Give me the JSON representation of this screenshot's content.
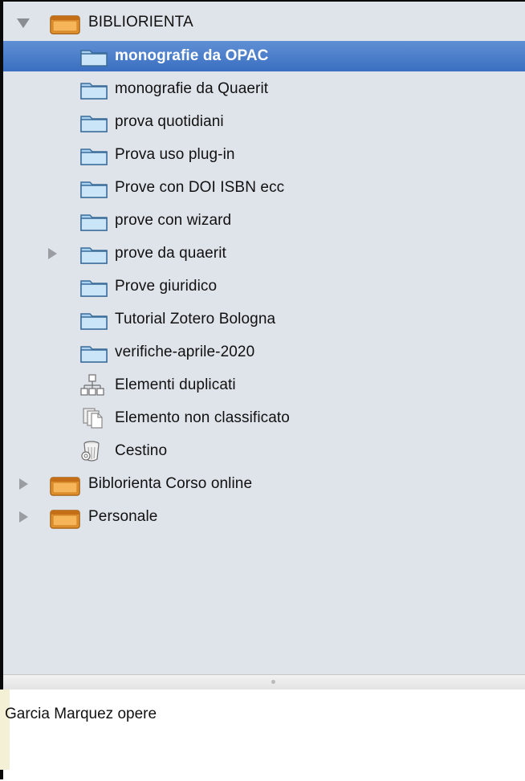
{
  "tree": {
    "root": {
      "label": "BIBLIORIENTA",
      "icon": "library-icon",
      "expanded": true
    },
    "items": [
      {
        "label": "monografie da OPAC",
        "icon": "folder-icon",
        "selected": true
      },
      {
        "label": "monografie da Quaerit",
        "icon": "folder-icon"
      },
      {
        "label": "prova quotidiani",
        "icon": "folder-icon"
      },
      {
        "label": "Prova uso plug-in",
        "icon": "folder-icon"
      },
      {
        "label": "Prove con DOI ISBN ecc",
        "icon": "folder-icon"
      },
      {
        "label": "prove con wizard",
        "icon": "folder-icon"
      },
      {
        "label": "prove da quaerit",
        "icon": "folder-icon",
        "has_children": true
      },
      {
        "label": "Prove giuridico",
        "icon": "folder-icon"
      },
      {
        "label": "Tutorial Zotero Bologna",
        "icon": "folder-icon"
      },
      {
        "label": "verifiche-aprile-2020",
        "icon": "folder-icon"
      },
      {
        "label": "Elementi duplicati",
        "icon": "duplicates-icon"
      },
      {
        "label": "Elemento non classificato",
        "icon": "unfiled-icon"
      },
      {
        "label": "Cestino",
        "icon": "trash-icon"
      }
    ],
    "libraries": [
      {
        "label": "Biblorienta Corso online",
        "icon": "library-icon",
        "expanded": false
      },
      {
        "label": "Personale",
        "icon": "library-icon",
        "expanded": false
      }
    ]
  },
  "notes": {
    "text": "Garcia Marquez opere"
  },
  "colors": {
    "selection": "#3a6fc1",
    "pane": "#dfe3ea",
    "folder": "#8fc3e6",
    "library": "#e8952f"
  }
}
